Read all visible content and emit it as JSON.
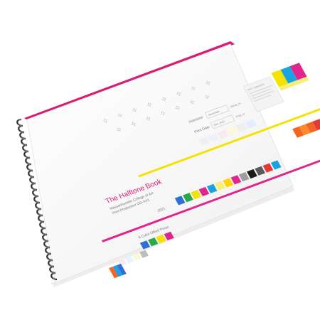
{
  "book": {
    "title": "The Halftone Book",
    "institution": "Massachusetts College of Art",
    "course": "Print Production GD-XX1",
    "year": "2021",
    "press_label": "8 Color Offset Press",
    "form_labels": {
      "instructor": "Instructor",
      "print_date": "Print Date",
      "instructor_value": "November",
      "date_value": "Dec. 2021",
      "serial_no": "Serial_nr",
      "print_no": "Print_nr",
      "file_label": "FILE: Colors2021"
    }
  },
  "colors": {
    "cyan": "#1aa3e0",
    "magenta": "#e0268a",
    "yellow": "#f4e200",
    "orange": "#f26522",
    "red": "#e53935",
    "blue": "#2f6fd6",
    "green": "#29a84a",
    "black": "#1b1b1b"
  },
  "icons": {
    "spiral_binding": "spiral-binding-icon",
    "registration_mark": "registration-mark-icon"
  }
}
